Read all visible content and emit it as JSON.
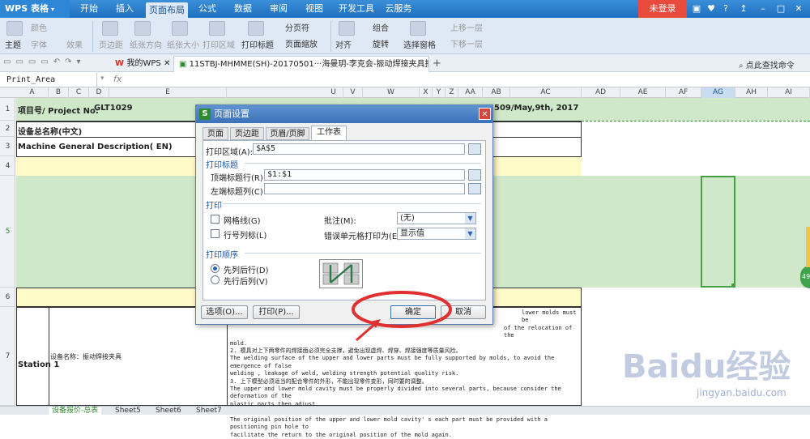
{
  "app": {
    "name": "WPS 表格",
    "login": "未登录"
  },
  "menu": [
    "开始",
    "插入",
    "页面布局",
    "公式",
    "数据",
    "审阅",
    "视图",
    "开发工具",
    "云服务"
  ],
  "ribbon": {
    "theme": "主题",
    "colors": "颜色",
    "fonts": "字体",
    "effects": "效果",
    "margins": "页边距",
    "orientation": "纸张方向",
    "size": "纸张大小",
    "print_area": "打印区域",
    "print_titles": "打印标题",
    "page_break": "分页符",
    "page_scale": "页面缩放",
    "align": "对齐",
    "group": "组合",
    "rotate": "旋转",
    "selection_pane": "选择窗格",
    "bring_forward": "上移一层",
    "send_backward": "下移一层"
  },
  "tabs": {
    "my_wps": "我的WPS",
    "doc": "11STBJ-MHMME(SH)-20170501···海曼玥-李克会-振动焊接夹具报价单.xlsx *",
    "search": "点此查找命令"
  },
  "formula_bar": {
    "name_box": "Print_Area",
    "fx": "fx"
  },
  "columns": [
    "A",
    "B",
    "C",
    "D",
    "E",
    "U",
    "V",
    "W",
    "X",
    "Y",
    "Z",
    "AA",
    "AB",
    "AC",
    "AD",
    "AE",
    "AF",
    "AG",
    "AH",
    "AI"
  ],
  "rows": [
    "1",
    "2",
    "3",
    "4",
    "5",
    "6",
    "7"
  ],
  "sheet": {
    "project_label": "项目号/ Project No:",
    "project_no": "GLT1029",
    "date": "509/May,9th, 2017",
    "device_cn": "设备总名称(中文)",
    "device_en": "Machine General Description( EN)",
    "station": "Station 1",
    "device_name": "设备名称：振动焊接夹具",
    "notes": [
      "lower molds must be",
      "of the relocation of the",
      "mold.",
      "2. 模具对上下两零件的焊接面必须完全支撑，避免出现虚焊、焊穿、焊接强度等质量风险。",
      "The welding surface of the upper and lower parts must be fully supported by molds, to avoid the emergence of false",
      "welding , leakage of weld, welding strength potential quality risk.",
      "3. 上下模型必须适当的配合零件的外形，不能出现零件变形，同时要的调整。",
      "The upper and lower mold cavity must be properly divided into several parts, because consider the deformation of the",
      "plastic parts then adjust.",
      "4. 上下模型必须装具的位置必须有各有定位销孔，便于再次恢复到模具原始位置。",
      "The original position of the upper and lower mold cavity' s each part must be provided with a positioning pin hole to",
      "facilitate the return to the original position of the mold again."
    ]
  },
  "sheet_tabs": [
    "设备报价-总表",
    "Sheet5",
    "Sheet6",
    "Sheet7"
  ],
  "dialog": {
    "title": "页面设置",
    "tabs": [
      "页面",
      "页边距",
      "页眉/页脚",
      "工作表"
    ],
    "print_area_label": "打印区域(A):",
    "print_area_value": "$A$5",
    "print_titles_group": "打印标题",
    "top_rows_label": "顶端标题行(R):",
    "top_rows_value": "$1:$1",
    "left_cols_label": "左端标题列(C):",
    "left_cols_value": "",
    "print_group": "打印",
    "gridlines_label": "网格线(G)",
    "gridlines_checked": false,
    "row_col_headers_label": "行号列标(L)",
    "row_col_headers_checked": false,
    "comments_label": "批注(M):",
    "comments_value": "(无)",
    "errors_label": "错误单元格打印为(E):",
    "errors_value": "显示值",
    "order_group": "打印顺序",
    "order_down_then_over": "先列后行(D)",
    "order_over_then_down": "先行后列(V)",
    "selected_order": "down_then_over",
    "options_btn": "选项(O)...",
    "print_btn": "打印(P)...",
    "ok_btn": "确定",
    "cancel_btn": "取消"
  },
  "watermark": {
    "brand": "Baidu经验",
    "url": "jingyan.baidu.com"
  },
  "colors": {
    "accent": "#2a62b3",
    "selection_green": "#cfe8c9",
    "highlight_yellow": "#fffbc8",
    "annotation_red": "#e03030"
  }
}
